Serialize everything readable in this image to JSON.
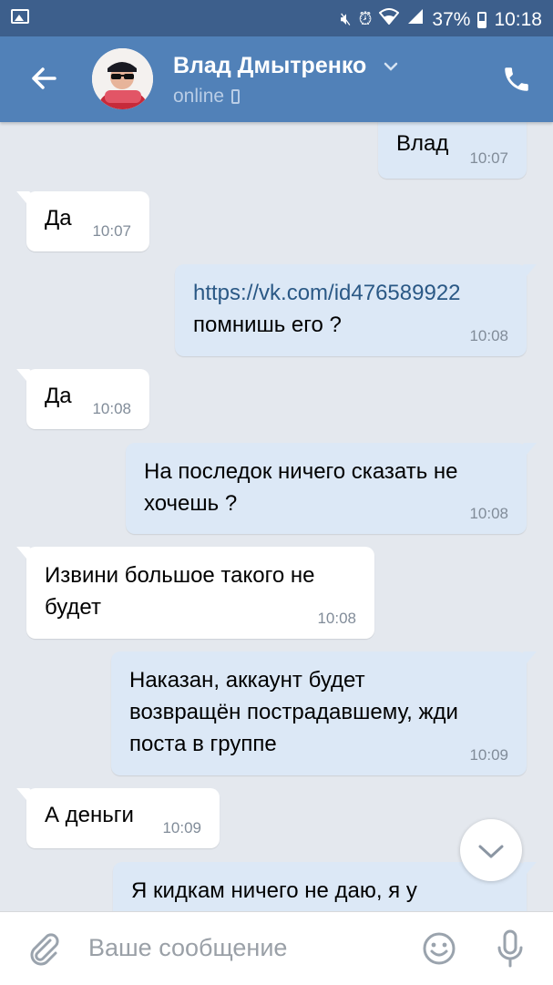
{
  "status_bar": {
    "battery": "37%",
    "time": "10:18"
  },
  "header": {
    "name": "Влад Дмытренко",
    "status": "online"
  },
  "messages": [
    {
      "dir": "out",
      "lines": [
        "Влад"
      ],
      "time": "10:07"
    },
    {
      "dir": "in",
      "lines": [
        "Да"
      ],
      "time": "10:07"
    },
    {
      "dir": "out",
      "link": "https://vk.com/id476589922",
      "lines": [
        "помнишь его ?"
      ],
      "time": "10:08"
    },
    {
      "dir": "in",
      "lines": [
        "Да"
      ],
      "time": "10:08"
    },
    {
      "dir": "out",
      "lines": [
        "На последок ничего сказать не",
        "хочешь ?"
      ],
      "time": "10:08"
    },
    {
      "dir": "in",
      "lines": [
        "Извини большое такого не",
        "будет"
      ],
      "time": "10:08"
    },
    {
      "dir": "out",
      "lines": [
        "Наказан, аккаунт будет",
        "возвращён пострадавшему, жди",
        "поста в группе"
      ],
      "time": "10:09"
    },
    {
      "dir": "in",
      "lines": [
        "А деньги"
      ],
      "time": "10:09"
    },
    {
      "dir": "out",
      "lines": [
        "Я кидкам ничего не даю, я у"
      ],
      "time": ""
    }
  ],
  "composer": {
    "placeholder": "Ваше сообщение"
  },
  "icons": [
    "gallery-icon",
    "mute-icon",
    "alarm-icon",
    "wifi-icon",
    "signal-icon",
    "battery-icon",
    "back-arrow-icon",
    "chevron-down-icon",
    "phone-icon",
    "attach-icon",
    "emoji-icon",
    "mic-icon"
  ]
}
